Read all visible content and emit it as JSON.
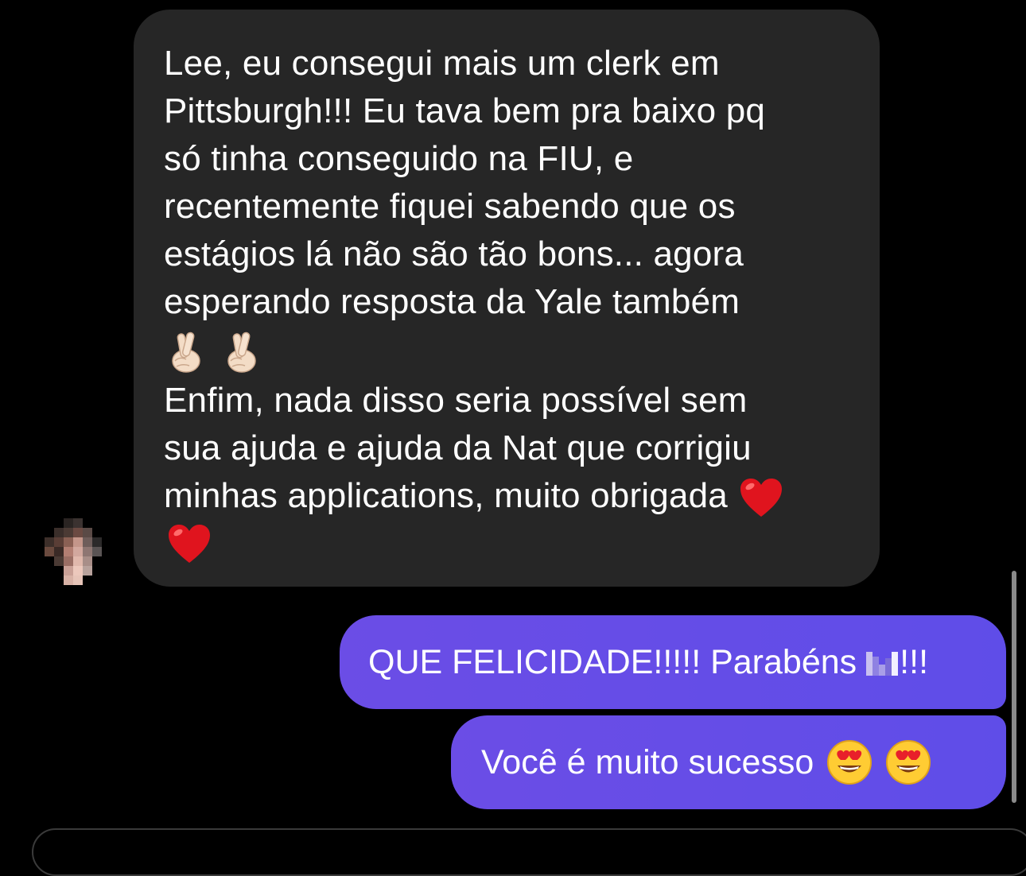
{
  "thread": {
    "incoming_message": {
      "lines": [
        "Lee, eu consegui mais um clerk em",
        "Pittsburgh!!! Eu tava bem pra baixo pq",
        "só tinha conseguido na FIU, e",
        "recentemente fiquei sabendo que os",
        "estágios lá não são tão bons... agora",
        "esperando resposta da Yale também",
        "Enfim, nada disso seria possível sem",
        "sua ajuda e ajuda da Nat que corrigiu",
        "minhas applications, muito obrigada"
      ],
      "emoji_line_icons": [
        "crossed-fingers-icon",
        "crossed-fingers-icon"
      ],
      "heart_icons": [
        "red-heart-icon",
        "red-heart-icon"
      ]
    },
    "outgoing_messages": [
      {
        "text_before": "QUE FELICIDADE!!!!! Parabéns",
        "text_after": "!!!",
        "censored_name": true
      },
      {
        "text": "Você é muito sucesso",
        "emoji_icons": [
          "heart-eyes-icon",
          "heart-eyes-icon"
        ]
      }
    ]
  },
  "colors": {
    "background": "#000000",
    "incoming_bubble": "#262626",
    "outgoing_bubble": "#6a4ce8",
    "text": "#ffffff"
  }
}
